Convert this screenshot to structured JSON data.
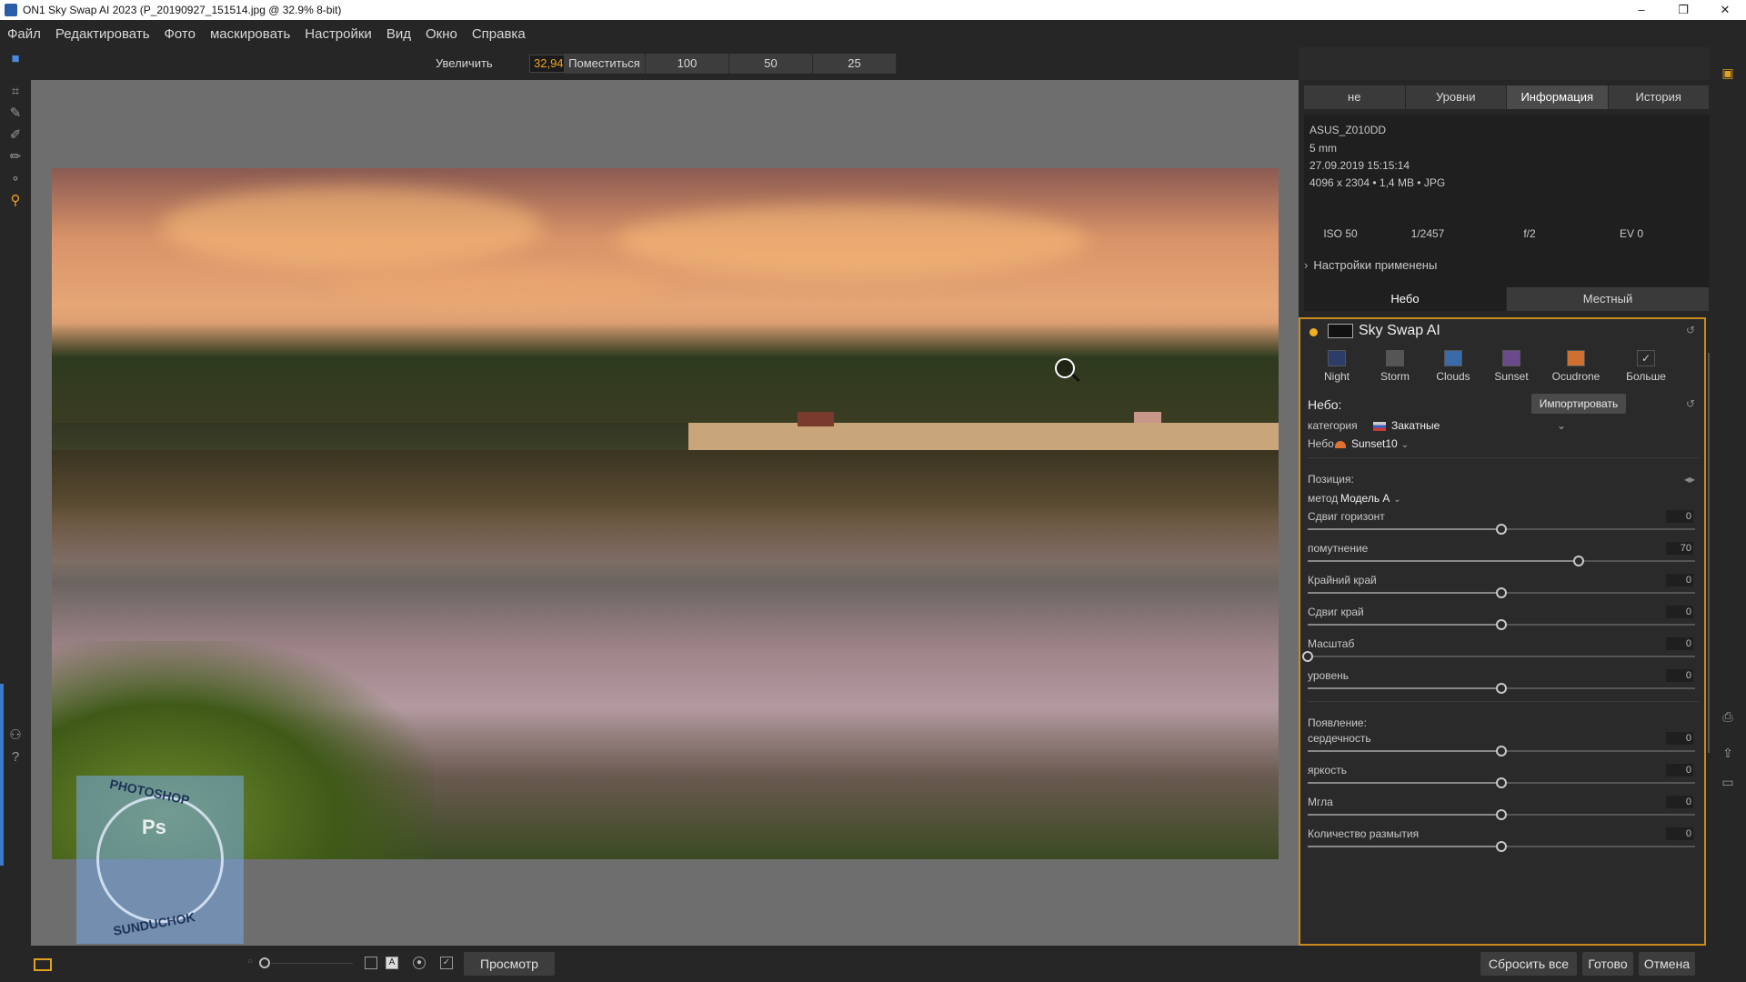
{
  "window": {
    "title": "ON1 Sky Swap AI 2023 (P_20190927_151514.jpg @ 32.9% 8-bit)",
    "controls": [
      "–",
      "❐",
      "✕"
    ]
  },
  "menu": [
    "Файл",
    "Редактировать",
    "Фото",
    "маскировать",
    "Настройки",
    "Вид",
    "Окно",
    "Справка"
  ],
  "zoom": {
    "label": "Увеличить",
    "value": "32,94",
    "buttons": [
      "Поместиться",
      "100",
      "50",
      "25"
    ]
  },
  "watermark": {
    "top": "PHOTOSHOP",
    "center": "Ps",
    "bottom": "SUNDUCHOK"
  },
  "right_panel": {
    "tabs": [
      "не",
      "Уровни",
      "Информация",
      "История"
    ],
    "active_tab": "Информация",
    "info": {
      "camera": "ASUS_Z010DD",
      "focal": "5 mm",
      "date": "27.09.2019 15:15:14",
      "size": "4096 x 2304 • 1,4 MB • JPG",
      "exposure": [
        "ISO 50",
        "1/2457",
        "f/2",
        "EV 0"
      ]
    },
    "applied": "Настройки применены",
    "view_tabs": [
      "Небо",
      "Местный"
    ],
    "module_title": "Sky Swap AI",
    "presets": [
      "Night",
      "Storm",
      "Clouds",
      "Sunset",
      "Ocudrone",
      "Больше"
    ],
    "sky_section": "Небо:",
    "import": "Импортировать",
    "category_label": "категория",
    "category_value": "Закатные",
    "sky_label": "Небо",
    "sky_value": "Sunset10",
    "position_section": "Позиция:",
    "method_label": "метод",
    "method_value": "Модель А",
    "sliders": [
      {
        "label": "Сдвиг горизонт",
        "value": "0",
        "pos": 0.5
      },
      {
        "label": "помутнение",
        "value": "70",
        "pos": 0.7
      },
      {
        "label": "Крайний край",
        "value": "0",
        "pos": 0.5
      },
      {
        "label": "Сдвиг край",
        "value": "0",
        "pos": 0.5
      },
      {
        "label": "Масштаб",
        "value": "0",
        "pos": 0.0
      },
      {
        "label": "уровень",
        "value": "0",
        "pos": 0.5
      }
    ],
    "appearance_section": "Появление:",
    "appearance_sliders": [
      {
        "label": "сердечность",
        "value": "0",
        "pos": 0.5
      },
      {
        "label": "яркость",
        "value": "0",
        "pos": 0.5
      },
      {
        "label": "Мгла",
        "value": "0",
        "pos": 0.5
      },
      {
        "label": "Количество размытия",
        "value": "0",
        "pos": 0.5
      }
    ]
  },
  "bottom": {
    "preview": "Просмотр",
    "reset_all": "Сбросить все",
    "done": "Готово",
    "cancel": "Отмена",
    "a_label": "A"
  },
  "colors": {
    "accent": "#c98a1e",
    "zoom_value": "#f0a020",
    "canvas": "#6e6e6e"
  }
}
